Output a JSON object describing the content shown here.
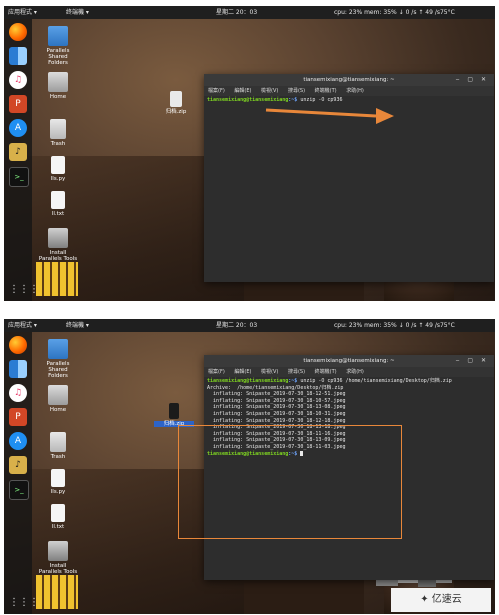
{
  "topbar": {
    "app_menu": "应用程式 ▾",
    "terminal_menu": "终端機 ▾",
    "time": "星期二 20：03",
    "stats": "cpu: 23% mem: 35% ↓ 0 /s ↑ 49 /s75°C"
  },
  "dock": {
    "items": [
      "firefox-icon",
      "finder-icon",
      "music-icon",
      "powerpoint-icon",
      "app-store-icon",
      "sound-icon",
      "terminal-icon",
      "app-grid-icon"
    ]
  },
  "desktop": {
    "icons": {
      "parallels": "Parallels Shared Folders",
      "home": "Home",
      "trash": "Trash",
      "lls": "lls.py",
      "ltxt": "ll.txt",
      "install": "Install Parallels Tools",
      "zip": "归档.zip"
    }
  },
  "terminal": {
    "title": "tiansemixiang@tiansemixiang: ~",
    "menu": [
      "檔案(F)",
      "編輯(E)",
      "檢視(V)",
      "搜尋(S)",
      "終端機(T)",
      "求助(H)"
    ],
    "prompt_user": "tiansemixiang@tiansemixiang",
    "prompt_path": ":~$",
    "command_top": " unzip -O cp936",
    "command_bottom": " unzip -O cp936 /home/tiansemixiang/Desktop/归档.zip",
    "output": [
      "Archive:  /home/tiansemixiang/Desktop/归档.zip",
      "  inflating: Snipaste_2019-07-30_18-12-51.jpeg",
      "  inflating: Snipaste_2019-07-30_18-10-57.jpeg",
      "  inflating: Snipaste_2019-07-30_18-13-08.jpeg",
      "  inflating: Snipaste_2019-07-30_18-10-31.jpeg",
      "  inflating: Snipaste_2019-07-30_18-12-18.jpeg",
      "  inflating: Snipaste_2019-07-30_18-13-18.jpeg",
      "  inflating: Snipaste_2019-07-30_18-11-16.jpeg",
      "  inflating: Snipaste_2019-07-30_18-13-09.jpeg",
      "  inflating: Snipaste_2019-07-30_18-11-03.jpeg"
    ]
  },
  "watermark": "亿速云",
  "colors": {
    "annotation": "#e8873a",
    "prompt_user": "#7ed321",
    "prompt_path": "#6fa6ff"
  }
}
